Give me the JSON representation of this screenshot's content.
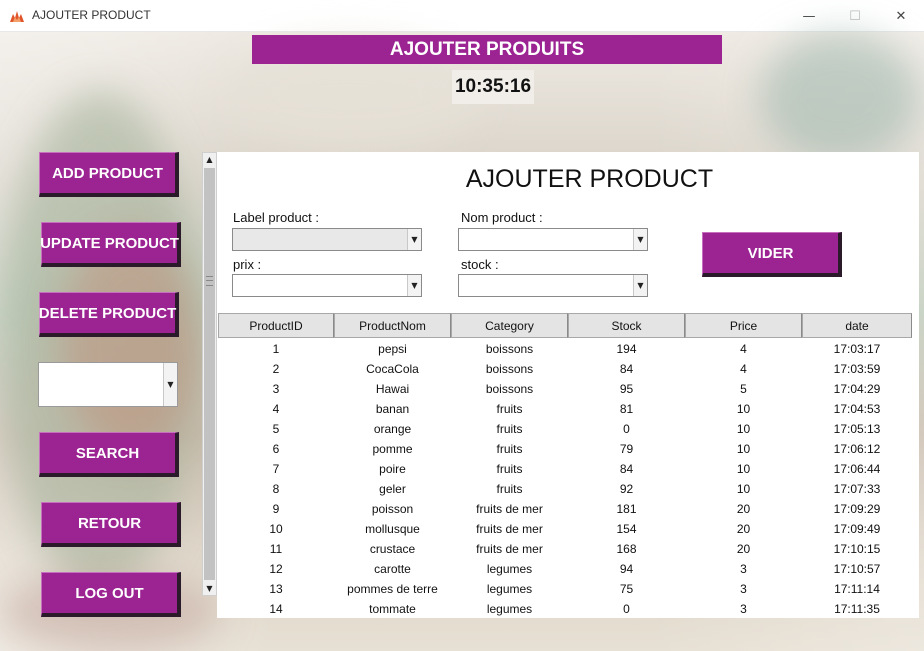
{
  "window": {
    "title": "AJOUTER PRODUCT",
    "controls": {
      "minimize": "—",
      "maximize": "☐",
      "close": "✕"
    }
  },
  "header": {
    "title": "AJOUTER PRODUITS",
    "clock": "10:35:16"
  },
  "sidebar": {
    "add": "ADD PRODUCT",
    "update": "UPDATE PRODUCT",
    "delete": "DELETE PRODUCT",
    "search_combo_value": "",
    "search": "SEARCH",
    "retour": "RETOUR",
    "logout": "LOG OUT"
  },
  "form": {
    "title": "AJOUTER PRODUCT",
    "label_product": "Label product :",
    "nom_product": "Nom product :",
    "prix": "prix :",
    "stock": "stock :",
    "vider": "VIDER"
  },
  "table": {
    "columns": [
      "ProductID",
      "ProductNom",
      "Category",
      "Stock",
      "Price",
      "date"
    ],
    "rows": [
      [
        "1",
        "pepsi",
        "boissons",
        "194",
        "4",
        "17:03:17"
      ],
      [
        "2",
        "CocaCola",
        "boissons",
        "84",
        "4",
        "17:03:59"
      ],
      [
        "3",
        "Hawai",
        "boissons",
        "95",
        "5",
        "17:04:29"
      ],
      [
        "4",
        "banan",
        "fruits",
        "81",
        "10",
        "17:04:53"
      ],
      [
        "5",
        "orange",
        "fruits",
        "0",
        "10",
        "17:05:13"
      ],
      [
        "6",
        "pomme",
        "fruits",
        "79",
        "10",
        "17:06:12"
      ],
      [
        "7",
        "poire",
        "fruits",
        "84",
        "10",
        "17:06:44"
      ],
      [
        "8",
        "geler",
        "fruits",
        "92",
        "10",
        "17:07:33"
      ],
      [
        "9",
        "poisson",
        "fruits de mer",
        "181",
        "20",
        "17:09:29"
      ],
      [
        "10",
        "mollusque",
        "fruits de mer",
        "154",
        "20",
        "17:09:49"
      ],
      [
        "11",
        "crustace",
        "fruits de mer",
        "168",
        "20",
        "17:10:15"
      ],
      [
        "12",
        "carotte",
        "legumes",
        "94",
        "3",
        "17:10:57"
      ],
      [
        "13",
        "pommes de terre",
        "legumes",
        "75",
        "3",
        "17:11:14"
      ],
      [
        "14",
        "tommate",
        "legumes",
        "0",
        "3",
        "17:11:35"
      ]
    ]
  },
  "colors": {
    "accent": "#9b2392"
  },
  "icons": {
    "app": "app-flame-icon",
    "dropdown": "chevron-down-icon",
    "scroll_up": "arrow-up-icon",
    "scroll_down": "arrow-down-icon"
  }
}
